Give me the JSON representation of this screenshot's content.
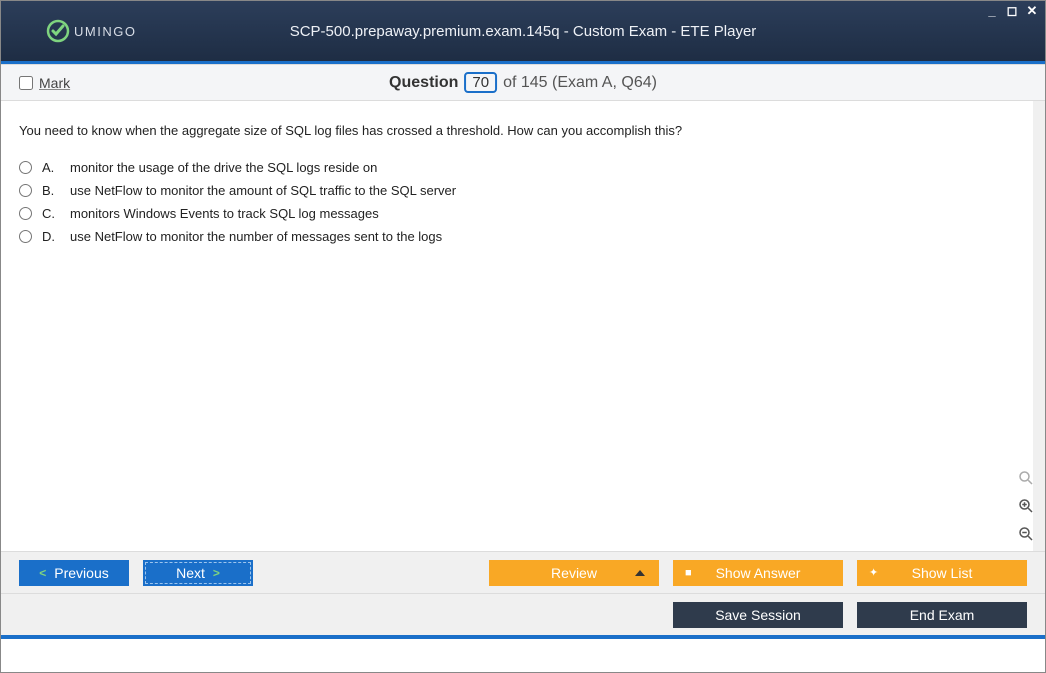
{
  "logo_text": "UMINGO",
  "window_title": "SCP-500.prepaway.premium.exam.145q - Custom Exam - ETE Player",
  "header": {
    "mark_label": "Mark",
    "question_label": "Question",
    "current_number": "70",
    "of_text": "of 145 (Exam A, Q64)"
  },
  "question_text": "You need to know when the aggregate size of SQL log files has crossed a threshold. How can you accomplish this?",
  "answers": [
    {
      "letter": "A.",
      "text": "monitor the usage of the drive the SQL logs reside on"
    },
    {
      "letter": "B.",
      "text": "use NetFlow to monitor the amount of SQL traffic to the SQL server"
    },
    {
      "letter": "C.",
      "text": "monitors Windows Events to track SQL log messages"
    },
    {
      "letter": "D.",
      "text": "use NetFlow to monitor the number of messages sent to the logs"
    }
  ],
  "buttons": {
    "previous": "Previous",
    "next": "Next",
    "review": "Review",
    "show_answer": "Show Answer",
    "show_list": "Show List",
    "save_session": "Save Session",
    "end_exam": "End Exam"
  }
}
